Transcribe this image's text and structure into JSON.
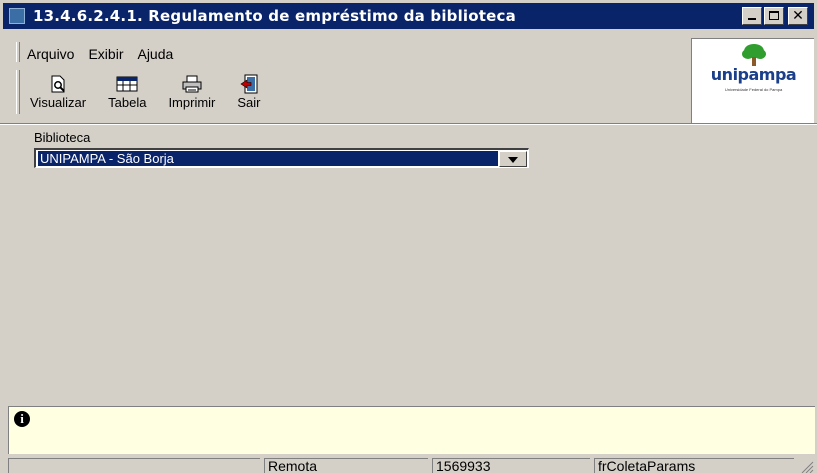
{
  "window": {
    "title": "13.4.6.2.4.1. Regulamento de empréstimo da biblioteca"
  },
  "menu": {
    "items": [
      {
        "label": "Arquivo"
      },
      {
        "label": "Exibir"
      },
      {
        "label": "Ajuda"
      }
    ]
  },
  "toolbar": {
    "buttons": [
      {
        "label": "Visualizar",
        "icon": "preview-icon"
      },
      {
        "label": "Tabela",
        "icon": "table-icon"
      },
      {
        "label": "Imprimir",
        "icon": "printer-icon"
      },
      {
        "label": "Sair",
        "icon": "exit-icon"
      }
    ]
  },
  "logo": {
    "wordmark": "unipampa",
    "subtitle": "Universidade Federal do Pampa",
    "colors": {
      "tree": "#2f9e2f",
      "trunk": "#8b5a2b",
      "text": "#1b3f8b"
    }
  },
  "form": {
    "biblioteca_label": "Biblioteca",
    "biblioteca_value": "UNIPAMPA - São Borja"
  },
  "status": {
    "cells": [
      "",
      "Remota",
      "1569933",
      "frColetaParams"
    ]
  },
  "colors": {
    "titlebar": "#0a246a",
    "selection": "#0a246a",
    "face": "#d4d0c8",
    "info_panel": "#ffffe1"
  }
}
